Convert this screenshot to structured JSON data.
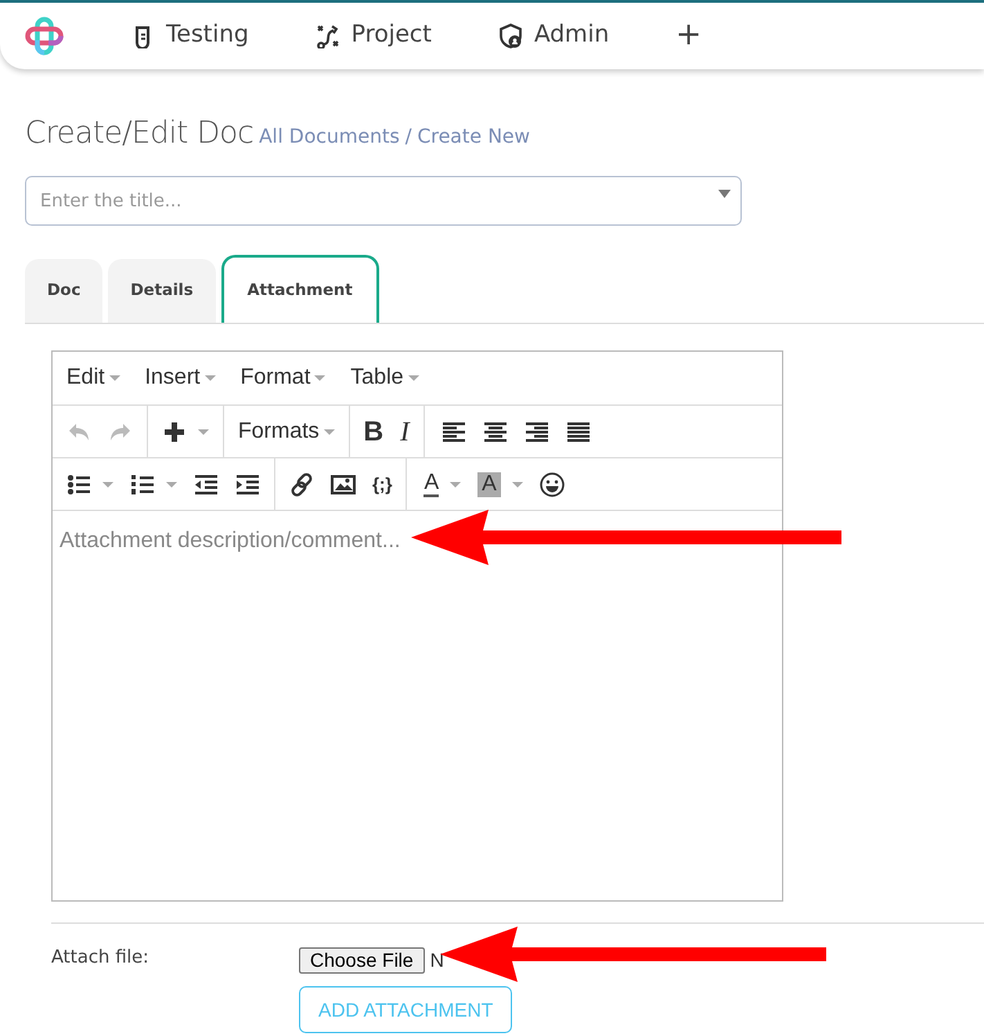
{
  "nav": {
    "items": [
      {
        "label": "Testing"
      },
      {
        "label": "Project"
      },
      {
        "label": "Admin"
      }
    ],
    "add_symbol": "+"
  },
  "header": {
    "title": "Create/Edit Doc",
    "breadcrumb": [
      {
        "label": "All Documents"
      },
      {
        "label": "Create New"
      }
    ],
    "separator": "/"
  },
  "title_field": {
    "placeholder": "Enter the title..."
  },
  "tabs": [
    {
      "label": "Doc",
      "selected": false
    },
    {
      "label": "Details",
      "selected": false
    },
    {
      "label": "Attachment",
      "selected": true
    }
  ],
  "editor": {
    "menus": [
      {
        "label": "Edit"
      },
      {
        "label": "Insert"
      },
      {
        "label": "Format"
      },
      {
        "label": "Table"
      }
    ],
    "undo": {
      "disabled": true
    },
    "redo": {
      "disabled": true
    },
    "formats_label": "Formats",
    "bold_label": "B",
    "italic_label": "I",
    "code_label": "{;}",
    "text_color_label": "A",
    "background_color_label": "A",
    "placeholder": "Attachment description/comment..."
  },
  "attach": {
    "label": "Attach file:",
    "choose_button": "Choose File",
    "file_status": "N",
    "add_button": "ADD ATTACHMENT"
  }
}
